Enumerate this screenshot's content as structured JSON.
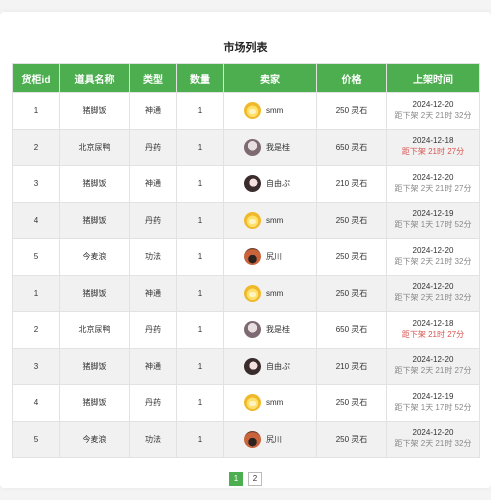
{
  "title": "市场列表",
  "headers": [
    "货柜id",
    "道具名称",
    "类型",
    "数量",
    "卖家",
    "价格",
    "上架时间"
  ],
  "rows": [
    {
      "id": "1",
      "name": "猪脚饭",
      "type": "神通",
      "qty": "1",
      "seller": "smm",
      "avatar": "smm",
      "price": "250 灵石",
      "date": "2024-12-20",
      "countdown": "距下架 2天 21时 32分",
      "urgent": false
    },
    {
      "id": "2",
      "name": "北京尿鸭",
      "type": "丹药",
      "qty": "1",
      "seller": "我是桂",
      "avatar": "wsg",
      "price": "650 灵石",
      "date": "2024-12-18",
      "countdown": "距下架 21时 27分",
      "urgent": true
    },
    {
      "id": "3",
      "name": "猪脚饭",
      "type": "神通",
      "qty": "1",
      "seller": "自由ぷ",
      "avatar": "zy",
      "price": "210 灵石",
      "date": "2024-12-20",
      "countdown": "距下架 2天 21时 27分",
      "urgent": false
    },
    {
      "id": "4",
      "name": "猪脚饭",
      "type": "丹药",
      "qty": "1",
      "seller": "smm",
      "avatar": "smm",
      "price": "250 灵石",
      "date": "2024-12-19",
      "countdown": "距下架 1天 17时 52分",
      "urgent": false
    },
    {
      "id": "5",
      "name": "今麦浪",
      "type": "功法",
      "qty": "1",
      "seller": "尻川",
      "avatar": "sc",
      "price": "250 灵石",
      "date": "2024-12-20",
      "countdown": "距下架 2天 21时 32分",
      "urgent": false
    },
    {
      "id": "1",
      "name": "猪脚饭",
      "type": "神通",
      "qty": "1",
      "seller": "smm",
      "avatar": "smm",
      "price": "250 灵石",
      "date": "2024-12-20",
      "countdown": "距下架 2天 21时 32分",
      "urgent": false
    },
    {
      "id": "2",
      "name": "北京尿鸭",
      "type": "丹药",
      "qty": "1",
      "seller": "我是桂",
      "avatar": "wsg",
      "price": "650 灵石",
      "date": "2024-12-18",
      "countdown": "距下架 21时 27分",
      "urgent": true
    },
    {
      "id": "3",
      "name": "猪脚饭",
      "type": "神通",
      "qty": "1",
      "seller": "自由ぷ",
      "avatar": "zy",
      "price": "210 灵石",
      "date": "2024-12-20",
      "countdown": "距下架 2天 21时 27分",
      "urgent": false
    },
    {
      "id": "4",
      "name": "猪脚饭",
      "type": "丹药",
      "qty": "1",
      "seller": "smm",
      "avatar": "smm",
      "price": "250 灵石",
      "date": "2024-12-19",
      "countdown": "距下架 1天 17时 52分",
      "urgent": false
    },
    {
      "id": "5",
      "name": "今麦浪",
      "type": "功法",
      "qty": "1",
      "seller": "尻川",
      "avatar": "sc",
      "price": "250 灵石",
      "date": "2024-12-20",
      "countdown": "距下架 2天 21时 32分",
      "urgent": false
    }
  ],
  "pagination": {
    "pages": [
      "1",
      "2"
    ],
    "current": "1"
  },
  "colors": {
    "header_bg": "#4cae4f",
    "urgent": "#d9534f",
    "stripe": "#f1f1f1"
  }
}
